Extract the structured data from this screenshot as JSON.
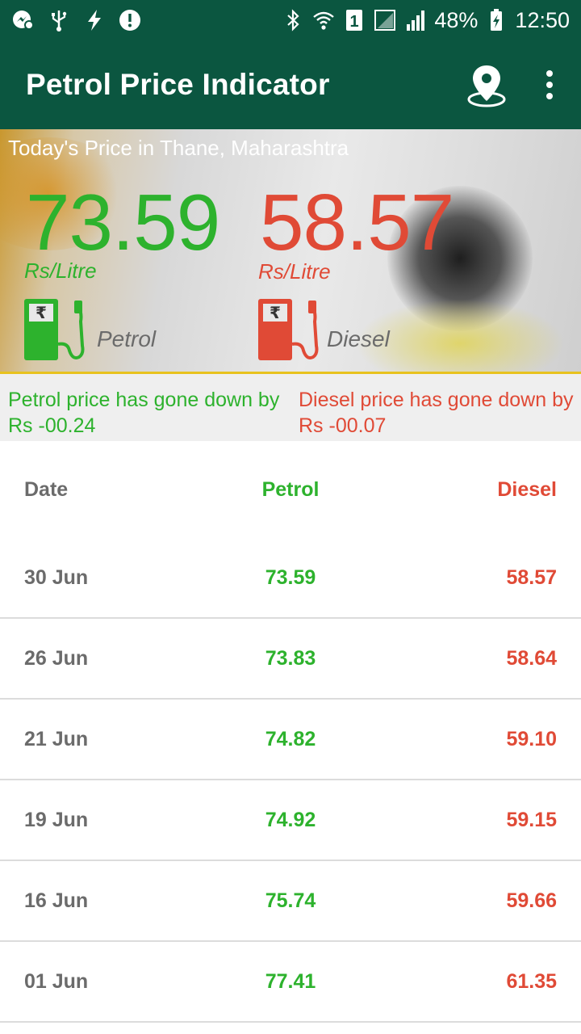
{
  "status_bar": {
    "battery_percent": "48%",
    "time": "12:50",
    "sim_slot": "1",
    "left_icons": [
      "messenger-icon",
      "usb-icon",
      "flash-icon",
      "alert-icon"
    ],
    "right_icons": [
      "bluetooth-icon",
      "wifi-icon",
      "sim-icon",
      "signal-icon",
      "battery-charging-icon"
    ]
  },
  "app_bar": {
    "title": "Petrol Price Indicator",
    "actions": [
      "location-pin-icon",
      "more-vert-icon"
    ]
  },
  "hero": {
    "caption": "Today's Price in Thane, Maharashtra",
    "petrol": {
      "price": "73.59",
      "unit": "Rs/Litre",
      "label": "Petrol",
      "color": "#2db22d"
    },
    "diesel": {
      "price": "58.57",
      "unit": "Rs/Litre",
      "label": "Diesel",
      "color": "#e04a36"
    }
  },
  "change": {
    "petrol": "Petrol price has gone down by Rs -00.24",
    "diesel": "Diesel price has gone down by Rs -00.07"
  },
  "table": {
    "headers": {
      "date": "Date",
      "petrol": "Petrol",
      "diesel": "Diesel"
    },
    "rows": [
      {
        "date": "30 Jun",
        "petrol": "73.59",
        "diesel": "58.57"
      },
      {
        "date": "26 Jun",
        "petrol": "73.83",
        "diesel": "58.64"
      },
      {
        "date": "21 Jun",
        "petrol": "74.82",
        "diesel": "59.10"
      },
      {
        "date": "19 Jun",
        "petrol": "74.92",
        "diesel": "59.15"
      },
      {
        "date": "16 Jun",
        "petrol": "75.74",
        "diesel": "59.66"
      },
      {
        "date": "01 Jun",
        "petrol": "77.41",
        "diesel": "61.35"
      }
    ]
  },
  "colors": {
    "app_bar": "#0b5640",
    "petrol": "#2db22d",
    "diesel": "#e04a36",
    "accent_line": "#e8c21e"
  }
}
